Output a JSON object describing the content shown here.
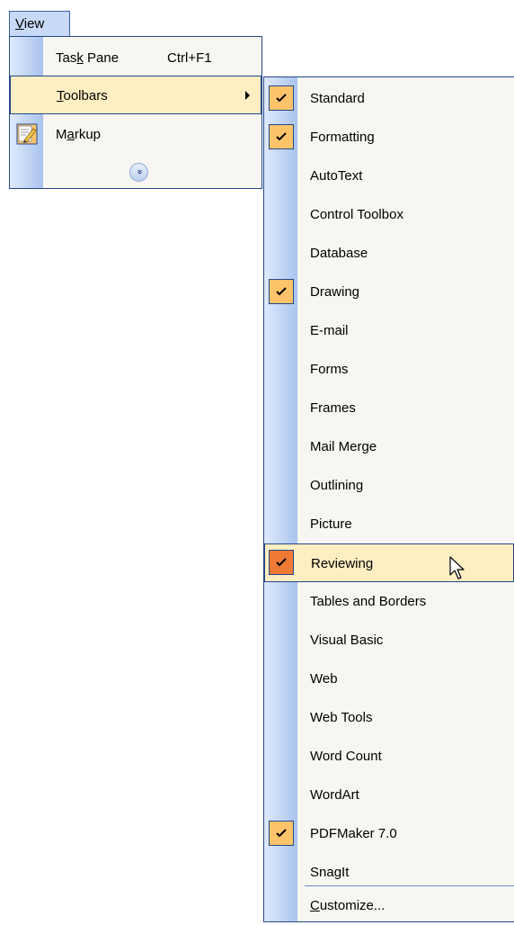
{
  "menubar": {
    "view_label_pre": "",
    "view_label_u": "V",
    "view_label_post": "iew"
  },
  "view_menu": {
    "task_pane": {
      "pre": "Tas",
      "u": "k",
      "post": " Pane",
      "shortcut": "Ctrl+F1"
    },
    "toolbars": {
      "pre": "",
      "u": "T",
      "post": "oolbars",
      "has_submenu": true
    },
    "markup": {
      "pre": "M",
      "u": "a",
      "post": "rkup",
      "icon": "markup-pencil-icon"
    },
    "expand_icon": "chevron-double-down-icon",
    "expand_glyph": "»"
  },
  "toolbars_submenu": {
    "items": [
      {
        "label": "Standard",
        "checked": true
      },
      {
        "label": "Formatting",
        "checked": true
      },
      {
        "label": "AutoText",
        "checked": false
      },
      {
        "label": "Control Toolbox",
        "checked": false
      },
      {
        "label": "Database",
        "checked": false
      },
      {
        "label": "Drawing",
        "checked": true
      },
      {
        "label": "E-mail",
        "checked": false
      },
      {
        "label": "Forms",
        "checked": false
      },
      {
        "label": "Frames",
        "checked": false
      },
      {
        "label": "Mail Merge",
        "checked": false
      },
      {
        "label": "Outlining",
        "checked": false
      },
      {
        "label": "Picture",
        "checked": false
      },
      {
        "label": "Reviewing",
        "checked": true,
        "hovered": true
      },
      {
        "label": "Tables and Borders",
        "checked": false
      },
      {
        "label": "Visual Basic",
        "checked": false
      },
      {
        "label": "Web",
        "checked": false
      },
      {
        "label": "Web Tools",
        "checked": false
      },
      {
        "label": "Word Count",
        "checked": false
      },
      {
        "label": "WordArt",
        "checked": false
      },
      {
        "label": "PDFMaker 7.0",
        "checked": true
      },
      {
        "label": "SnagIt",
        "checked": false
      }
    ],
    "customize": {
      "pre": "",
      "u": "C",
      "post": "ustomize..."
    }
  },
  "colors": {
    "menu_border": "#24488a",
    "highlight": "#ffeec2",
    "check_bg": "#ffc46a",
    "check_hover_bg": "#ef7a34",
    "stripe": "#a9c3ed"
  }
}
